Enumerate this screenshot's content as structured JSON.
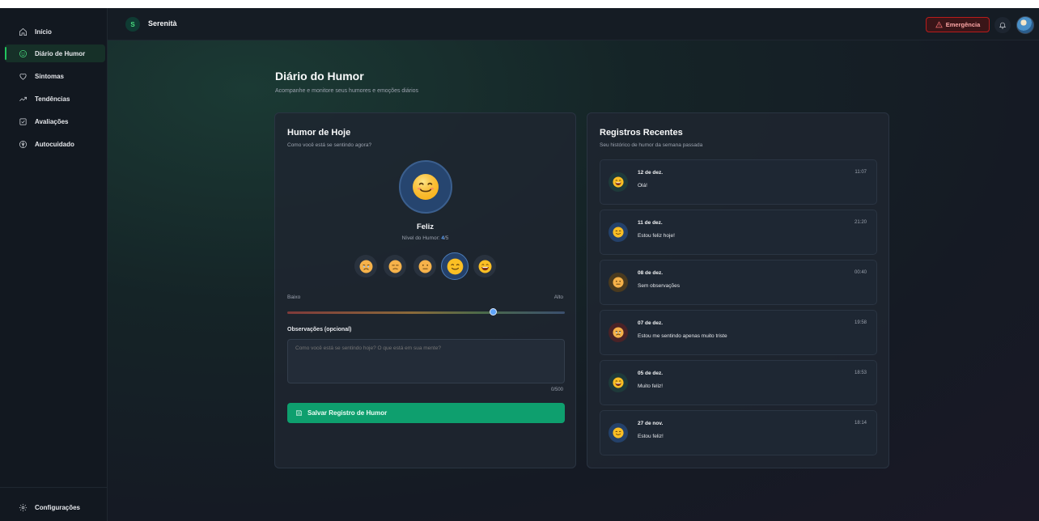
{
  "sidebar": {
    "items": [
      {
        "label": "Início",
        "icon": "home-icon"
      },
      {
        "label": "Diário de Humor",
        "icon": "smile-icon",
        "active": true
      },
      {
        "label": "Sintomas",
        "icon": "heart-icon"
      },
      {
        "label": "Tendências",
        "icon": "trending-icon"
      },
      {
        "label": "Avaliações",
        "icon": "checkbox-icon"
      },
      {
        "label": "Autocuidado",
        "icon": "lotus-icon"
      }
    ],
    "settings_label": "Configurações"
  },
  "topbar": {
    "brand_initial": "S",
    "brand_name": "Serenità",
    "emergency_label": "Emergência"
  },
  "page": {
    "title": "Diário do Humor",
    "subtitle": "Acompanhe e monitore seus humores e emoções diários"
  },
  "today": {
    "title": "Humor de Hoje",
    "subtitle": "Como você está se sentindo agora?",
    "mood_label": "Feliz",
    "level_prefix": "Nível do Humor: ",
    "level_value": "4",
    "level_max": "/5",
    "selected_level": 4,
    "range_low": "Baixo",
    "range_high": "Alto",
    "slider_fraction": 0.75,
    "observations_label": "Observações (opcional)",
    "observations_placeholder": "Como você está se sentindo hoje? O que está em sua mente?",
    "char_count": "0/500",
    "save_label": "Salvar Registro de Humor"
  },
  "recent": {
    "title": "Registros Recentes",
    "subtitle": "Seu histórico de humor da semana passada",
    "entries": [
      {
        "date": "12 de dez.",
        "note": "Olá!",
        "time": "11:07",
        "mood": 5
      },
      {
        "date": "11 de dez.",
        "note": "Estou feliz hoje!",
        "time": "21:20",
        "mood": 4
      },
      {
        "date": "08 de dez.",
        "note": "Sem observações",
        "time": "00:40",
        "mood": 3
      },
      {
        "date": "07 de dez.",
        "note": "Estou me sentindo apenas muito triste",
        "time": "19:58",
        "mood": 1
      },
      {
        "date": "05 de dez.",
        "note": "Muito feliz!",
        "time": "18:53",
        "mood": 5
      },
      {
        "date": "27 de nov.",
        "note": "Estou feliz!",
        "time": "18:14",
        "mood": 4
      }
    ]
  },
  "colors": {
    "accent_green": "#0e9f6e",
    "emergency_red": "#b91c1c",
    "level_blue": "#60a5fa"
  }
}
